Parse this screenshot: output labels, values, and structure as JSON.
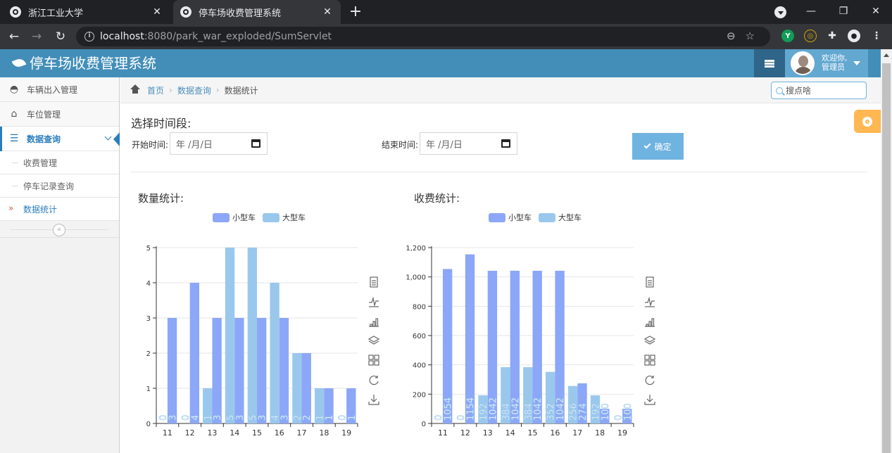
{
  "browser": {
    "tabs": [
      {
        "title": "浙江工业大学",
        "active": false
      },
      {
        "title": "停车场收费管理系统",
        "active": true
      }
    ],
    "new_tab": "+",
    "address": {
      "host": "localhost",
      "rest": ":8080/park_war_exploded/SumServlet"
    }
  },
  "app": {
    "brand": "停车场收费管理系统",
    "user_greeting": "欢迎你,",
    "user_name": "管理员"
  },
  "sidebar": {
    "items": [
      {
        "label": "车辆出入管理",
        "icon": "dashboard-icon"
      },
      {
        "label": "车位管理",
        "icon": "inbox-icon"
      },
      {
        "label": "数据查询",
        "icon": "list-icon",
        "open": true
      }
    ],
    "subitems": [
      {
        "label": "收费管理"
      },
      {
        "label": "停车记录查询"
      },
      {
        "label": "数据统计",
        "active": true
      }
    ],
    "collapse": "«"
  },
  "breadcrumb": {
    "home": "首页",
    "parent": "数据查询",
    "current": "数据统计"
  },
  "search": {
    "placeholder": "搜点啥"
  },
  "filter": {
    "title": "选择时间段:",
    "start_label": "开始时间:",
    "end_label": "结束时间:",
    "date_placeholder": "年 /月/日",
    "confirm": "确定"
  },
  "charts": {
    "count_title": "数量统计:",
    "fee_title": "收费统计:"
  },
  "colors": {
    "small_car": "#8ca7f7",
    "large_car": "#9ac8ed",
    "header": "#438eb9"
  },
  "chart_data": [
    {
      "type": "bar",
      "categories": [
        "11",
        "12",
        "13",
        "14",
        "15",
        "16",
        "17",
        "18",
        "19"
      ],
      "series": [
        {
          "name": "小型车",
          "values": [
            3,
            4,
            3,
            3,
            3,
            3,
            2,
            1,
            1
          ]
        },
        {
          "name": "大型车",
          "values": [
            0,
            0,
            1,
            5,
            5,
            4,
            2,
            1,
            0
          ]
        }
      ],
      "ylim": [
        0,
        5
      ],
      "yticks": [
        "0",
        "1",
        "2",
        "3",
        "4",
        "5"
      ],
      "legend": "top",
      "grid": true
    },
    {
      "type": "bar",
      "categories": [
        "11",
        "12",
        "13",
        "14",
        "15",
        "16",
        "17",
        "18",
        "19"
      ],
      "series": [
        {
          "name": "小型车",
          "values": [
            1054,
            1154,
            1042,
            1042,
            1042,
            1042,
            274,
            100,
            100
          ]
        },
        {
          "name": "大型车",
          "values": [
            0,
            0,
            192,
            384,
            384,
            352,
            256,
            192,
            0
          ]
        }
      ],
      "ylim": [
        0,
        1200
      ],
      "yticks": [
        "0",
        "200",
        "400",
        "600",
        "800",
        "1,000",
        "1,200"
      ],
      "legend": "top",
      "grid": true
    }
  ]
}
